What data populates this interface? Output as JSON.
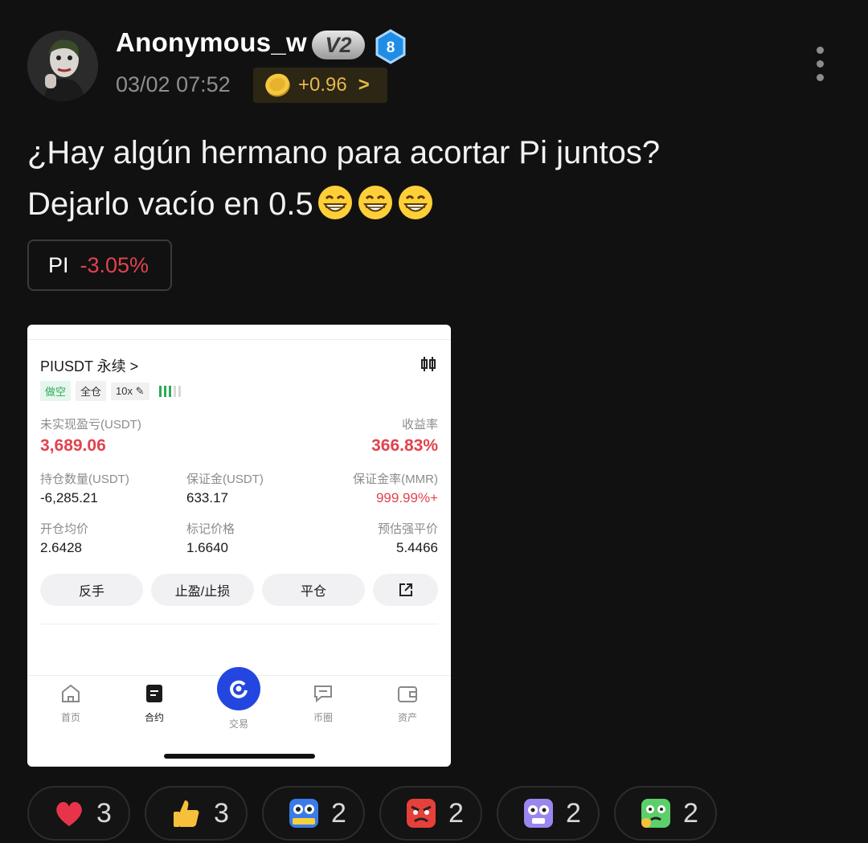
{
  "post": {
    "author": "Anonymous_w",
    "vip_badge": "V2",
    "level_badge": "8",
    "time": "03/02 07:52",
    "reward_amount": "+0.96",
    "text_line1": "¿Hay algún hermano para acortar Pi juntos?",
    "text_line2": "Dejarlo vacío en 0.5",
    "grin_emoji_count": 3,
    "tag": {
      "symbol": "PI",
      "change": "-3.05%"
    }
  },
  "screenshot": {
    "pair": "PIUSDT 永续 >",
    "chips": [
      "做空",
      "全仓",
      "10x"
    ],
    "risk_level_filled": 3,
    "risk_level_total": 5,
    "unrealized_pnl_label": "未实现盈亏(USDT)",
    "unrealized_pnl": "3,689.06",
    "roe_label": "收益率",
    "roe": "366.83%",
    "position_label": "持仓数量(USDT)",
    "position": "-6,285.21",
    "margin_label": "保证金(USDT)",
    "margin": "633.17",
    "mmr_label": "保证金率(MMR)",
    "mmr": "999.99%+",
    "entry_label": "开仓均价",
    "entry": "2.6428",
    "mark_label": "标记价格",
    "mark": "1.6640",
    "liq_label": "预估强平价",
    "liq": "5.4466",
    "buttons": [
      "反手",
      "止盈/止损",
      "平仓"
    ],
    "nav": [
      "首页",
      "合约",
      "交易",
      "币圈",
      "资产"
    ]
  },
  "reactions": [
    {
      "icon": "heart-icon",
      "count": "3"
    },
    {
      "icon": "thumbs-up-icon",
      "count": "3"
    },
    {
      "icon": "hodl-owl-icon",
      "count": "2"
    },
    {
      "icon": "angry-face-icon",
      "count": "2"
    },
    {
      "icon": "shocked-face-icon",
      "count": "2"
    },
    {
      "icon": "sick-face-icon",
      "count": "2"
    }
  ],
  "colors": {
    "background": "#111111",
    "red": "#e0434e",
    "gold": "#e6b84a",
    "green": "#2daa5a",
    "blue": "#2446e0"
  }
}
